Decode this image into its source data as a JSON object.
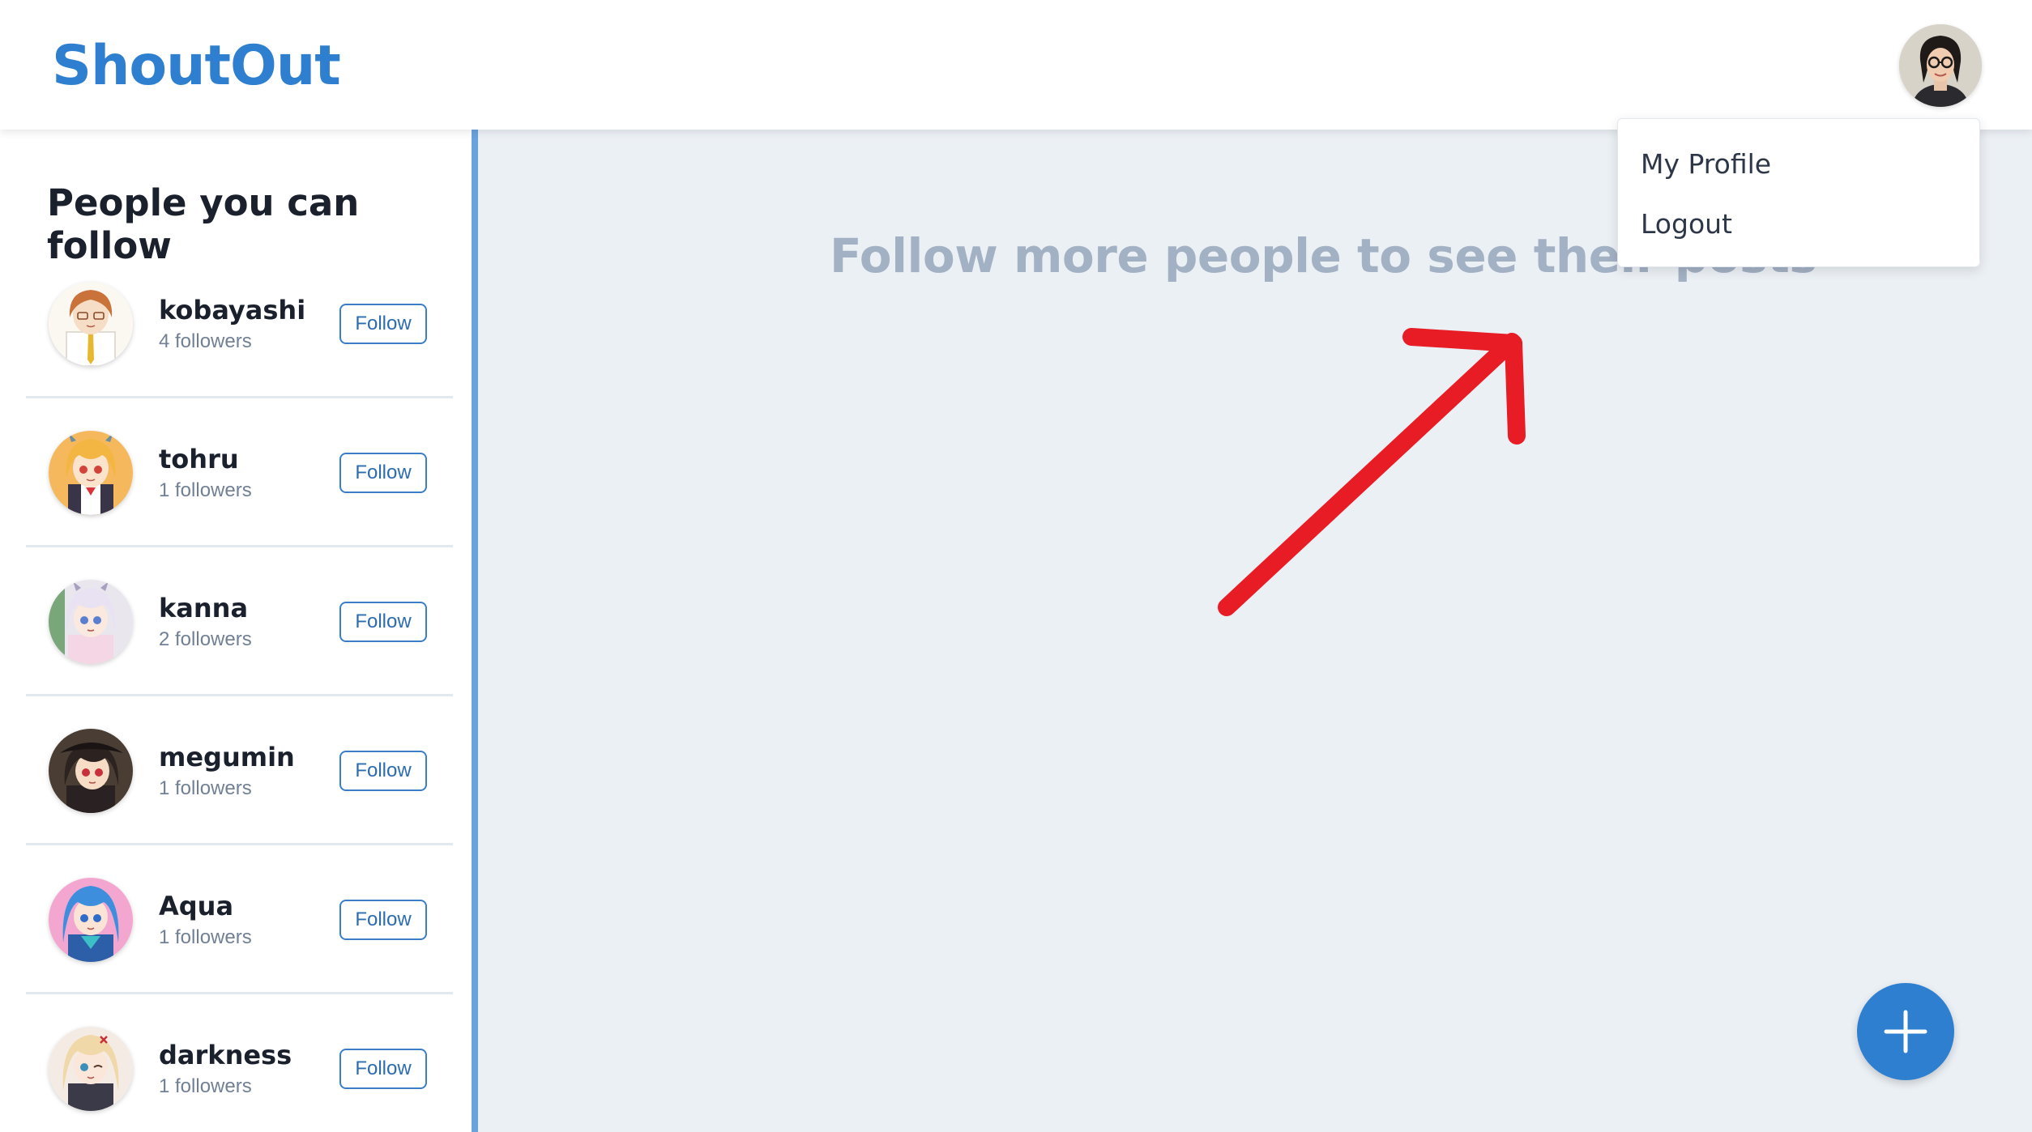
{
  "app": {
    "title": "ShoutOut"
  },
  "header": {
    "avatar_icon": "user-avatar-photo"
  },
  "dropdown": {
    "items": [
      {
        "label": "My Profile"
      },
      {
        "label": "Logout"
      }
    ]
  },
  "sidebar": {
    "title": "People you can follow",
    "users": [
      {
        "name": "kobayashi",
        "followers": "4 followers",
        "button": "Follow"
      },
      {
        "name": "tohru",
        "followers": "1 followers",
        "button": "Follow"
      },
      {
        "name": "kanna",
        "followers": "2 followers",
        "button": "Follow"
      },
      {
        "name": "megumin",
        "followers": "1 followers",
        "button": "Follow"
      },
      {
        "name": "Aqua",
        "followers": "1 followers",
        "button": "Follow"
      },
      {
        "name": "darkness",
        "followers": "1 followers",
        "button": "Follow"
      }
    ]
  },
  "main": {
    "empty_message": "Follow more people to see their posts"
  },
  "fab": {
    "icon": "plus-icon"
  },
  "colors": {
    "brand": "#2e7fd0",
    "arrow": "#e81c24",
    "sidebar_border": "#6aa3dc"
  }
}
